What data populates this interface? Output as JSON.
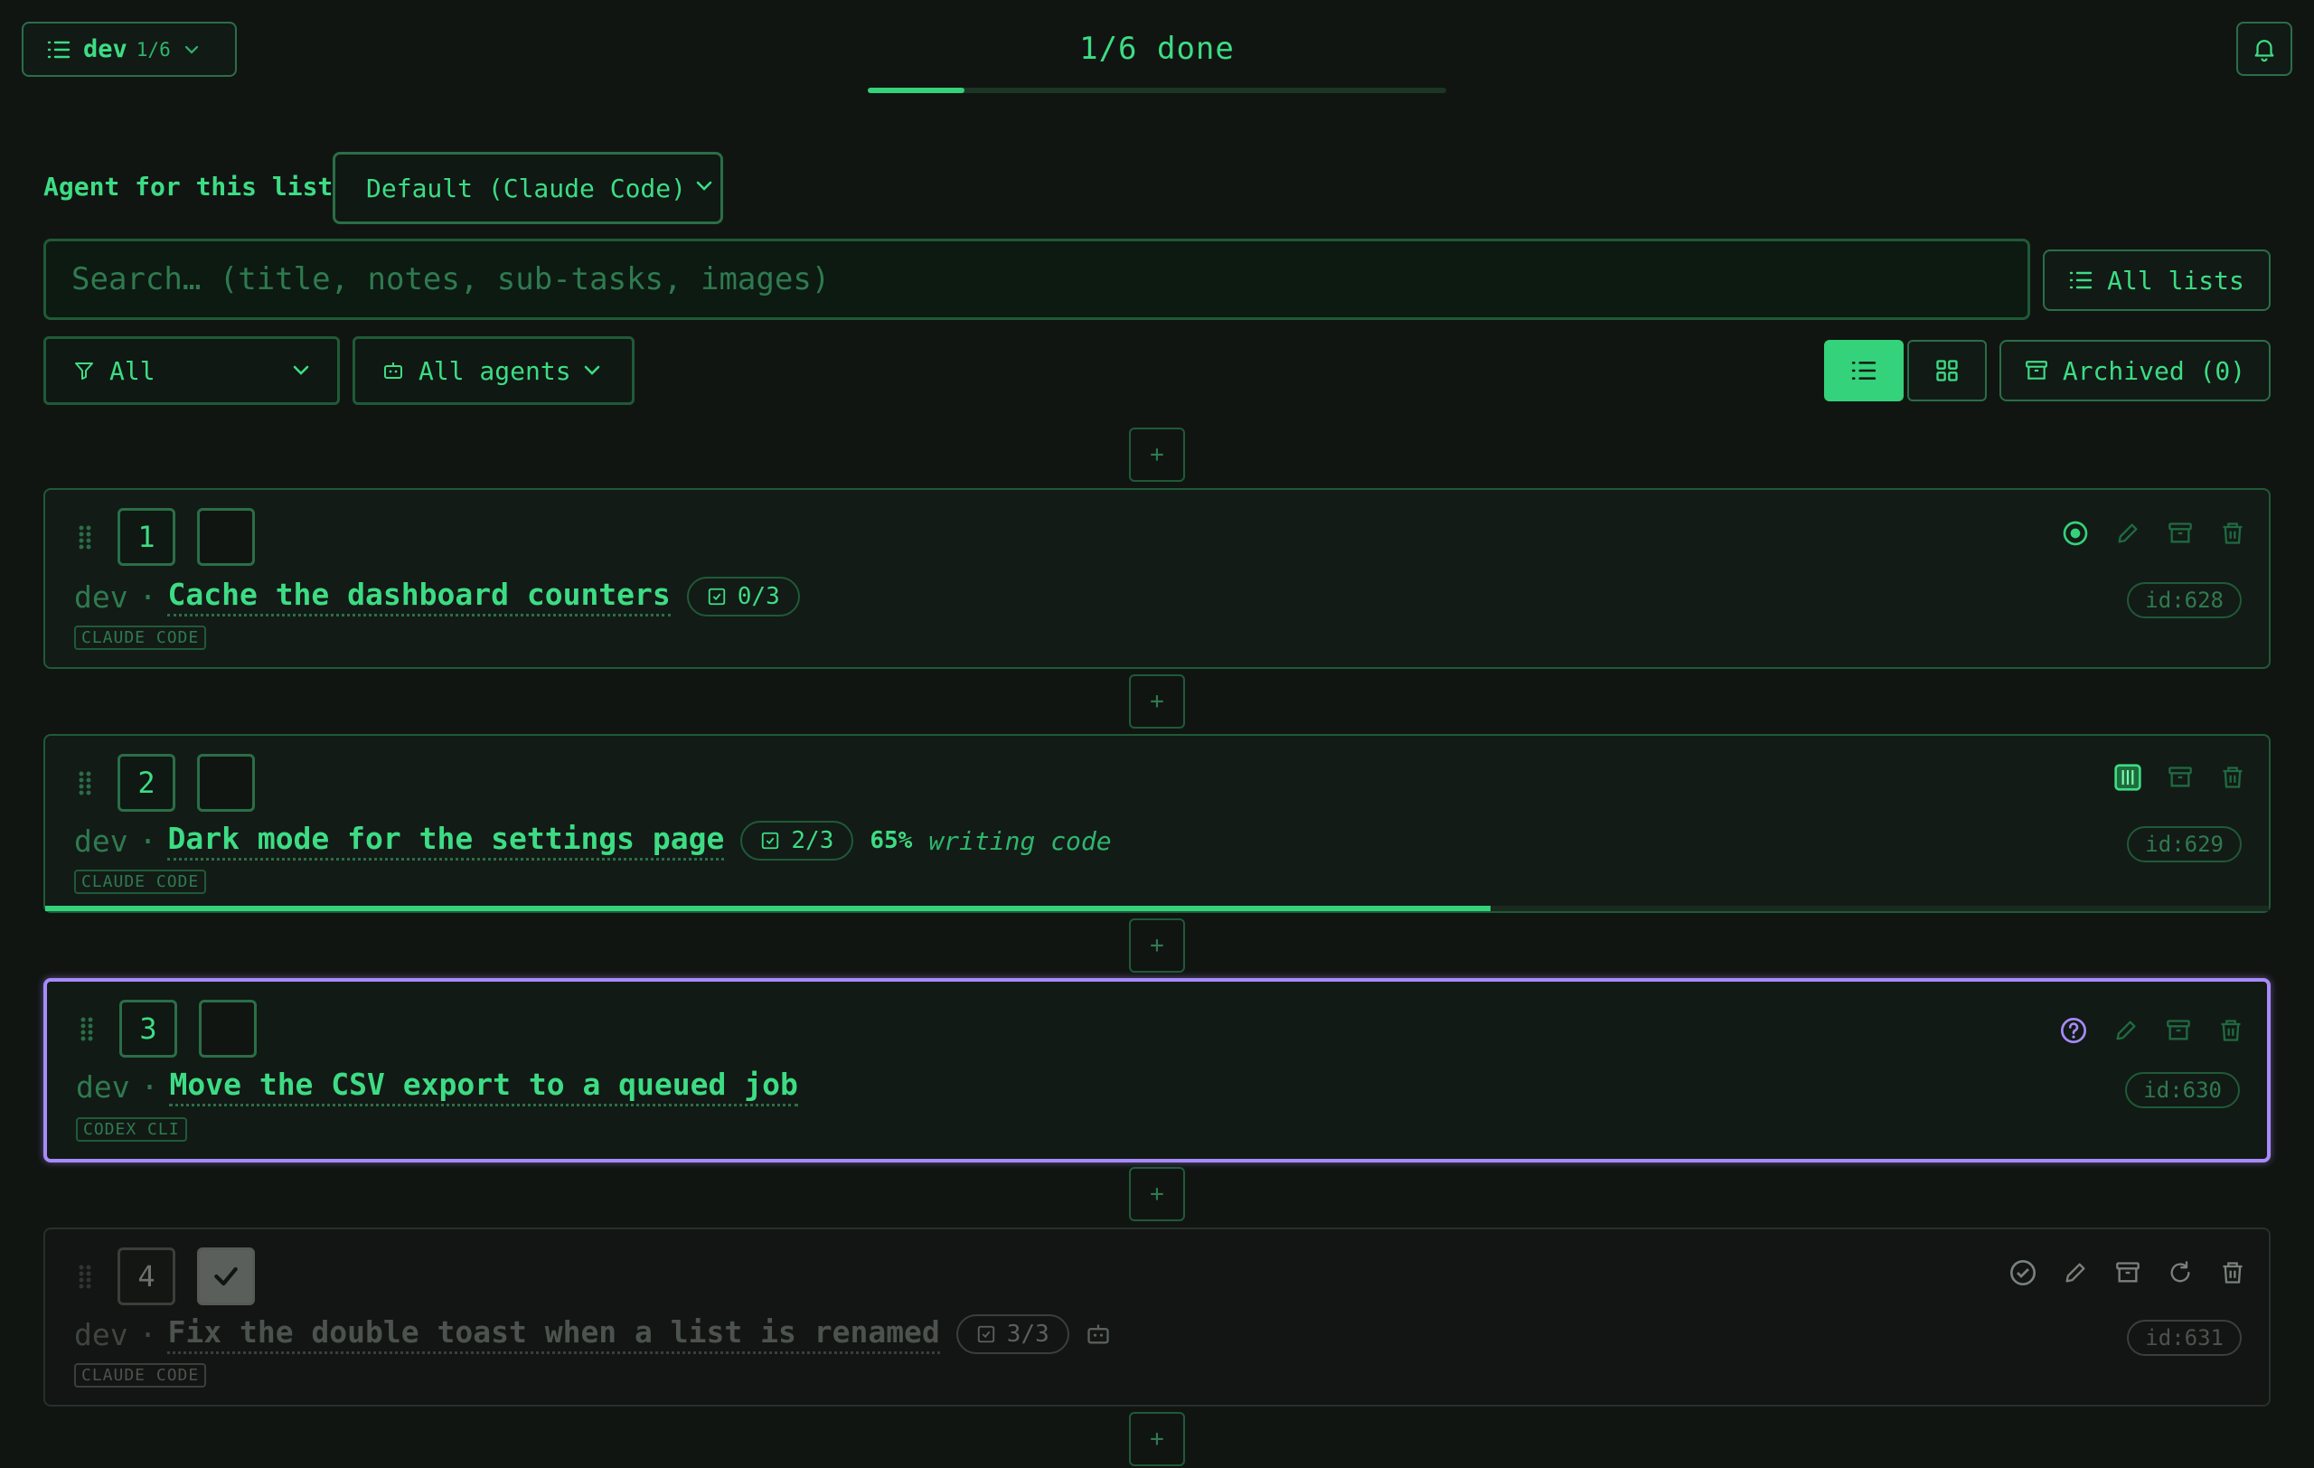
{
  "header": {
    "list_name": "dev",
    "list_count": "1/6",
    "done_text": "1/6 done",
    "progress_fraction": 0.167
  },
  "agent": {
    "label": "Agent for this list",
    "selected": "Default (Claude Code)"
  },
  "search": {
    "placeholder": "Search… (title, notes, sub-tasks, images)",
    "all_lists_label": "All lists"
  },
  "filters": {
    "status": "All",
    "agents": "All agents",
    "archived_label": "Archived (0)"
  },
  "colors": {
    "accent": "#34d27a",
    "background": "#111512",
    "active_outline": "#a78bfa"
  },
  "add_label": "+",
  "tasks": [
    {
      "number": "1",
      "list": "dev",
      "separator": "·",
      "title": "Cache the dashboard counters",
      "subtasks": "0/3",
      "agent": "CLAUDE CODE",
      "id": "id:628"
    },
    {
      "number": "2",
      "list": "dev",
      "separator": "·",
      "title": "Dark mode for the settings page",
      "subtasks": "2/3",
      "percent": "65%",
      "status": "writing code",
      "progress_fraction": 0.65,
      "agent": "CLAUDE CODE",
      "id": "id:629"
    },
    {
      "number": "3",
      "list": "dev",
      "separator": "·",
      "title": "Move the CSV export to a queued job",
      "agent": "CODEX CLI",
      "id": "id:630"
    },
    {
      "number": "4",
      "list": "dev",
      "separator": "·",
      "title": "Fix the double toast when a list is renamed",
      "subtasks": "3/3",
      "agent": "CLAUDE CODE",
      "id": "id:631"
    }
  ]
}
